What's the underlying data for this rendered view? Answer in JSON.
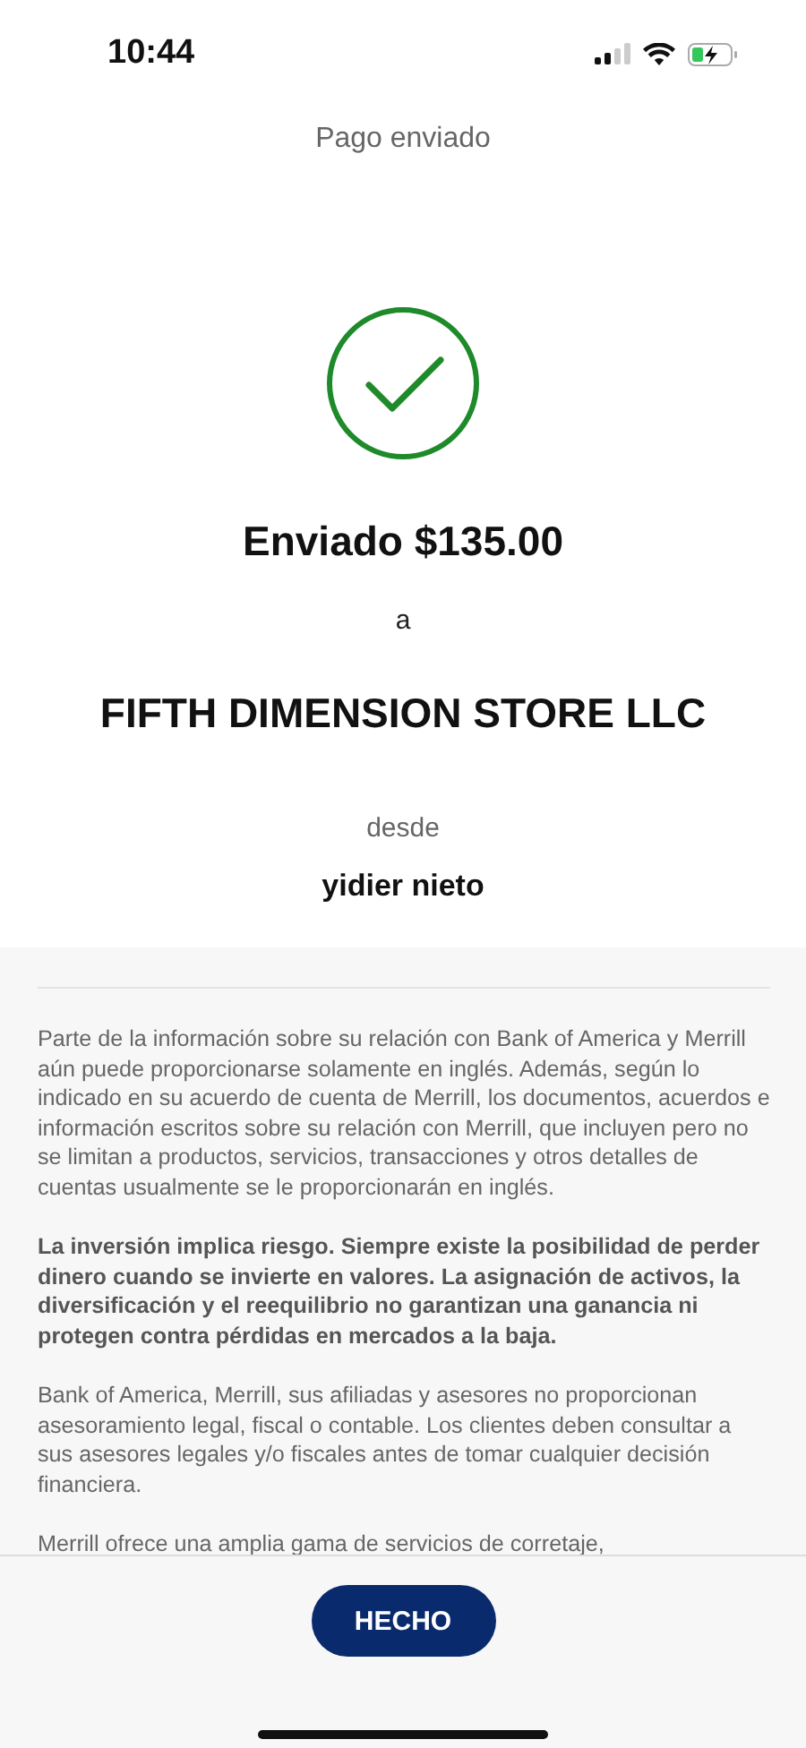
{
  "status_bar": {
    "time": "10:44"
  },
  "header": {
    "title": "Pago enviado"
  },
  "confirmation": {
    "amount": "Enviado $135.00",
    "to_label": "a",
    "recipient": "FIFTH DIMENSION STORE LLC",
    "from_label": "desde",
    "sender": "yidier nieto"
  },
  "disclosures": [
    {
      "kind": "plain",
      "text": "Parte de la información sobre su relación con Bank of America y Merrill aún puede proporcionarse solamente en inglés. Además, según lo indicado en su acuerdo de cuenta de Merrill, los documentos, acuerdos e información escritos sobre su relación con Merrill, que incluyen pero no se limitan a productos, servicios, transacciones y otros detalles de cuentas usualmente se le proporcionarán en inglés."
    },
    {
      "kind": "bold",
      "text": "La inversión implica riesgo. Siempre existe la posibilidad de perder dinero cuando se invierte en valores. La asignación de activos, la diversificación y el reequilibrio no garantizan una ganancia ni protegen contra pérdidas en mercados a la baja."
    },
    {
      "kind": "plain",
      "text": "Bank of America, Merrill, sus afiliadas y asesores no proporcionan asesoramiento legal, fiscal o contable. Los clientes deben consultar a sus asesores legales y/o fiscales antes de tomar cualquier decisión financiera."
    },
    {
      "kind": "plain",
      "text": "Merrill ofrece una amplia gama de servicios de corretaje,"
    }
  ],
  "done_button": {
    "label": "HECHO"
  }
}
